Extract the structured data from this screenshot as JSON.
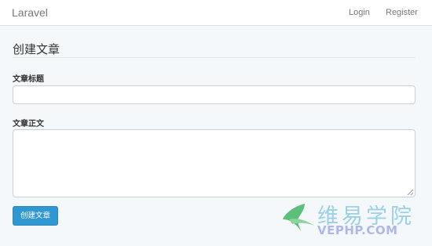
{
  "navbar": {
    "brand": "Laravel",
    "login_label": "Login",
    "register_label": "Register"
  },
  "form": {
    "heading": "创建文章",
    "title_label": "文章标题",
    "title_value": "",
    "body_label": "文章正文",
    "body_value": "",
    "submit_label": "创建文章"
  },
  "watermark": {
    "cn_text": "维易学院",
    "en_text": "VEPHP.COM",
    "icon": "leaf-arrow-logo-icon"
  },
  "colors": {
    "background": "#f5f8fa",
    "primary": "#3097d1",
    "watermark_green": "#5cc07a",
    "watermark_blue": "#9bd0e5"
  }
}
